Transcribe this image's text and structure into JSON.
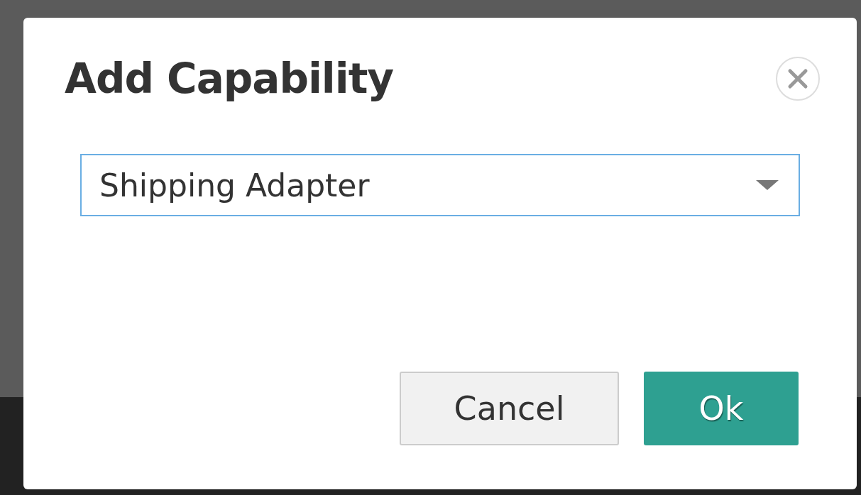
{
  "dialog": {
    "title": "Add Capability",
    "select": {
      "value": "Shipping Adapter"
    },
    "buttons": [
      {
        "label": "Cancel",
        "kind": "secondary"
      },
      {
        "label": "Ok",
        "kind": "primary"
      }
    ]
  }
}
